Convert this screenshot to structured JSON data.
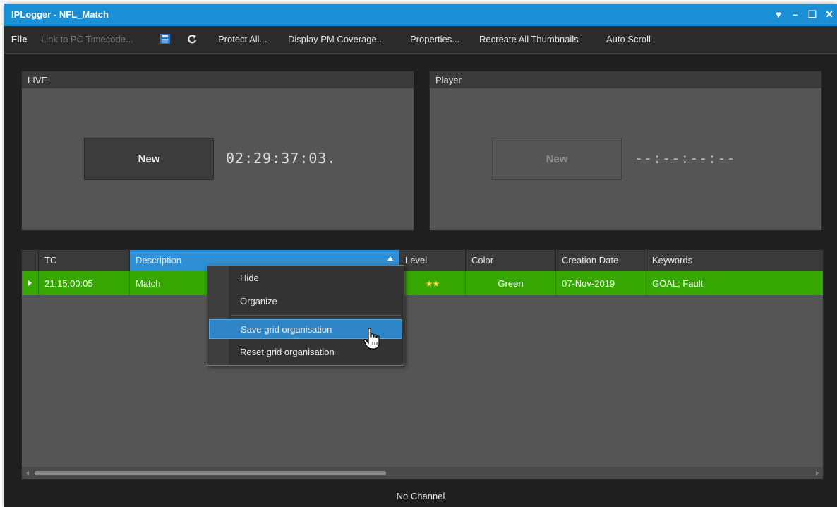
{
  "window": {
    "title": "IPLogger - NFL_Match",
    "controls": [
      "▾",
      "–",
      "☐",
      "✕"
    ]
  },
  "menu": {
    "file": "File",
    "link_timecode": "Link to PC Timecode...",
    "save_icon": "save-icon",
    "refresh_icon": "refresh-icon",
    "protect_all": "Protect All...",
    "display_pm": "Display PM Coverage...",
    "properties": "Properties...",
    "recreate_thumbs": "Recreate All Thumbnails",
    "auto_scroll": "Auto Scroll"
  },
  "live": {
    "header": "LIVE",
    "button": "New",
    "timecode": "02:29:37:03."
  },
  "player": {
    "header": "Player",
    "button": "New",
    "timecode": "--:--:--:--"
  },
  "grid": {
    "columns": [
      "TC",
      "Description",
      "Level",
      "Color",
      "Creation Date",
      "Keywords"
    ],
    "rows": [
      {
        "tc": "21:15:00:05",
        "description": "Match",
        "level": "★★",
        "level_stars": 2,
        "color": "Green",
        "creation_date": "07-Nov-2019",
        "keywords": "GOAL; Fault"
      }
    ]
  },
  "context_menu": {
    "items": [
      "Hide",
      "Organize",
      "Save grid organisation",
      "Reset grid organisation"
    ],
    "highlighted": "Save grid organisation"
  },
  "status": {
    "text": "No Channel"
  },
  "colors": {
    "titlebar": "#1a8fd6",
    "row_selected": "#35a700",
    "header_active": "#2e8fd6",
    "menu_highlight": "#2e86c9"
  }
}
